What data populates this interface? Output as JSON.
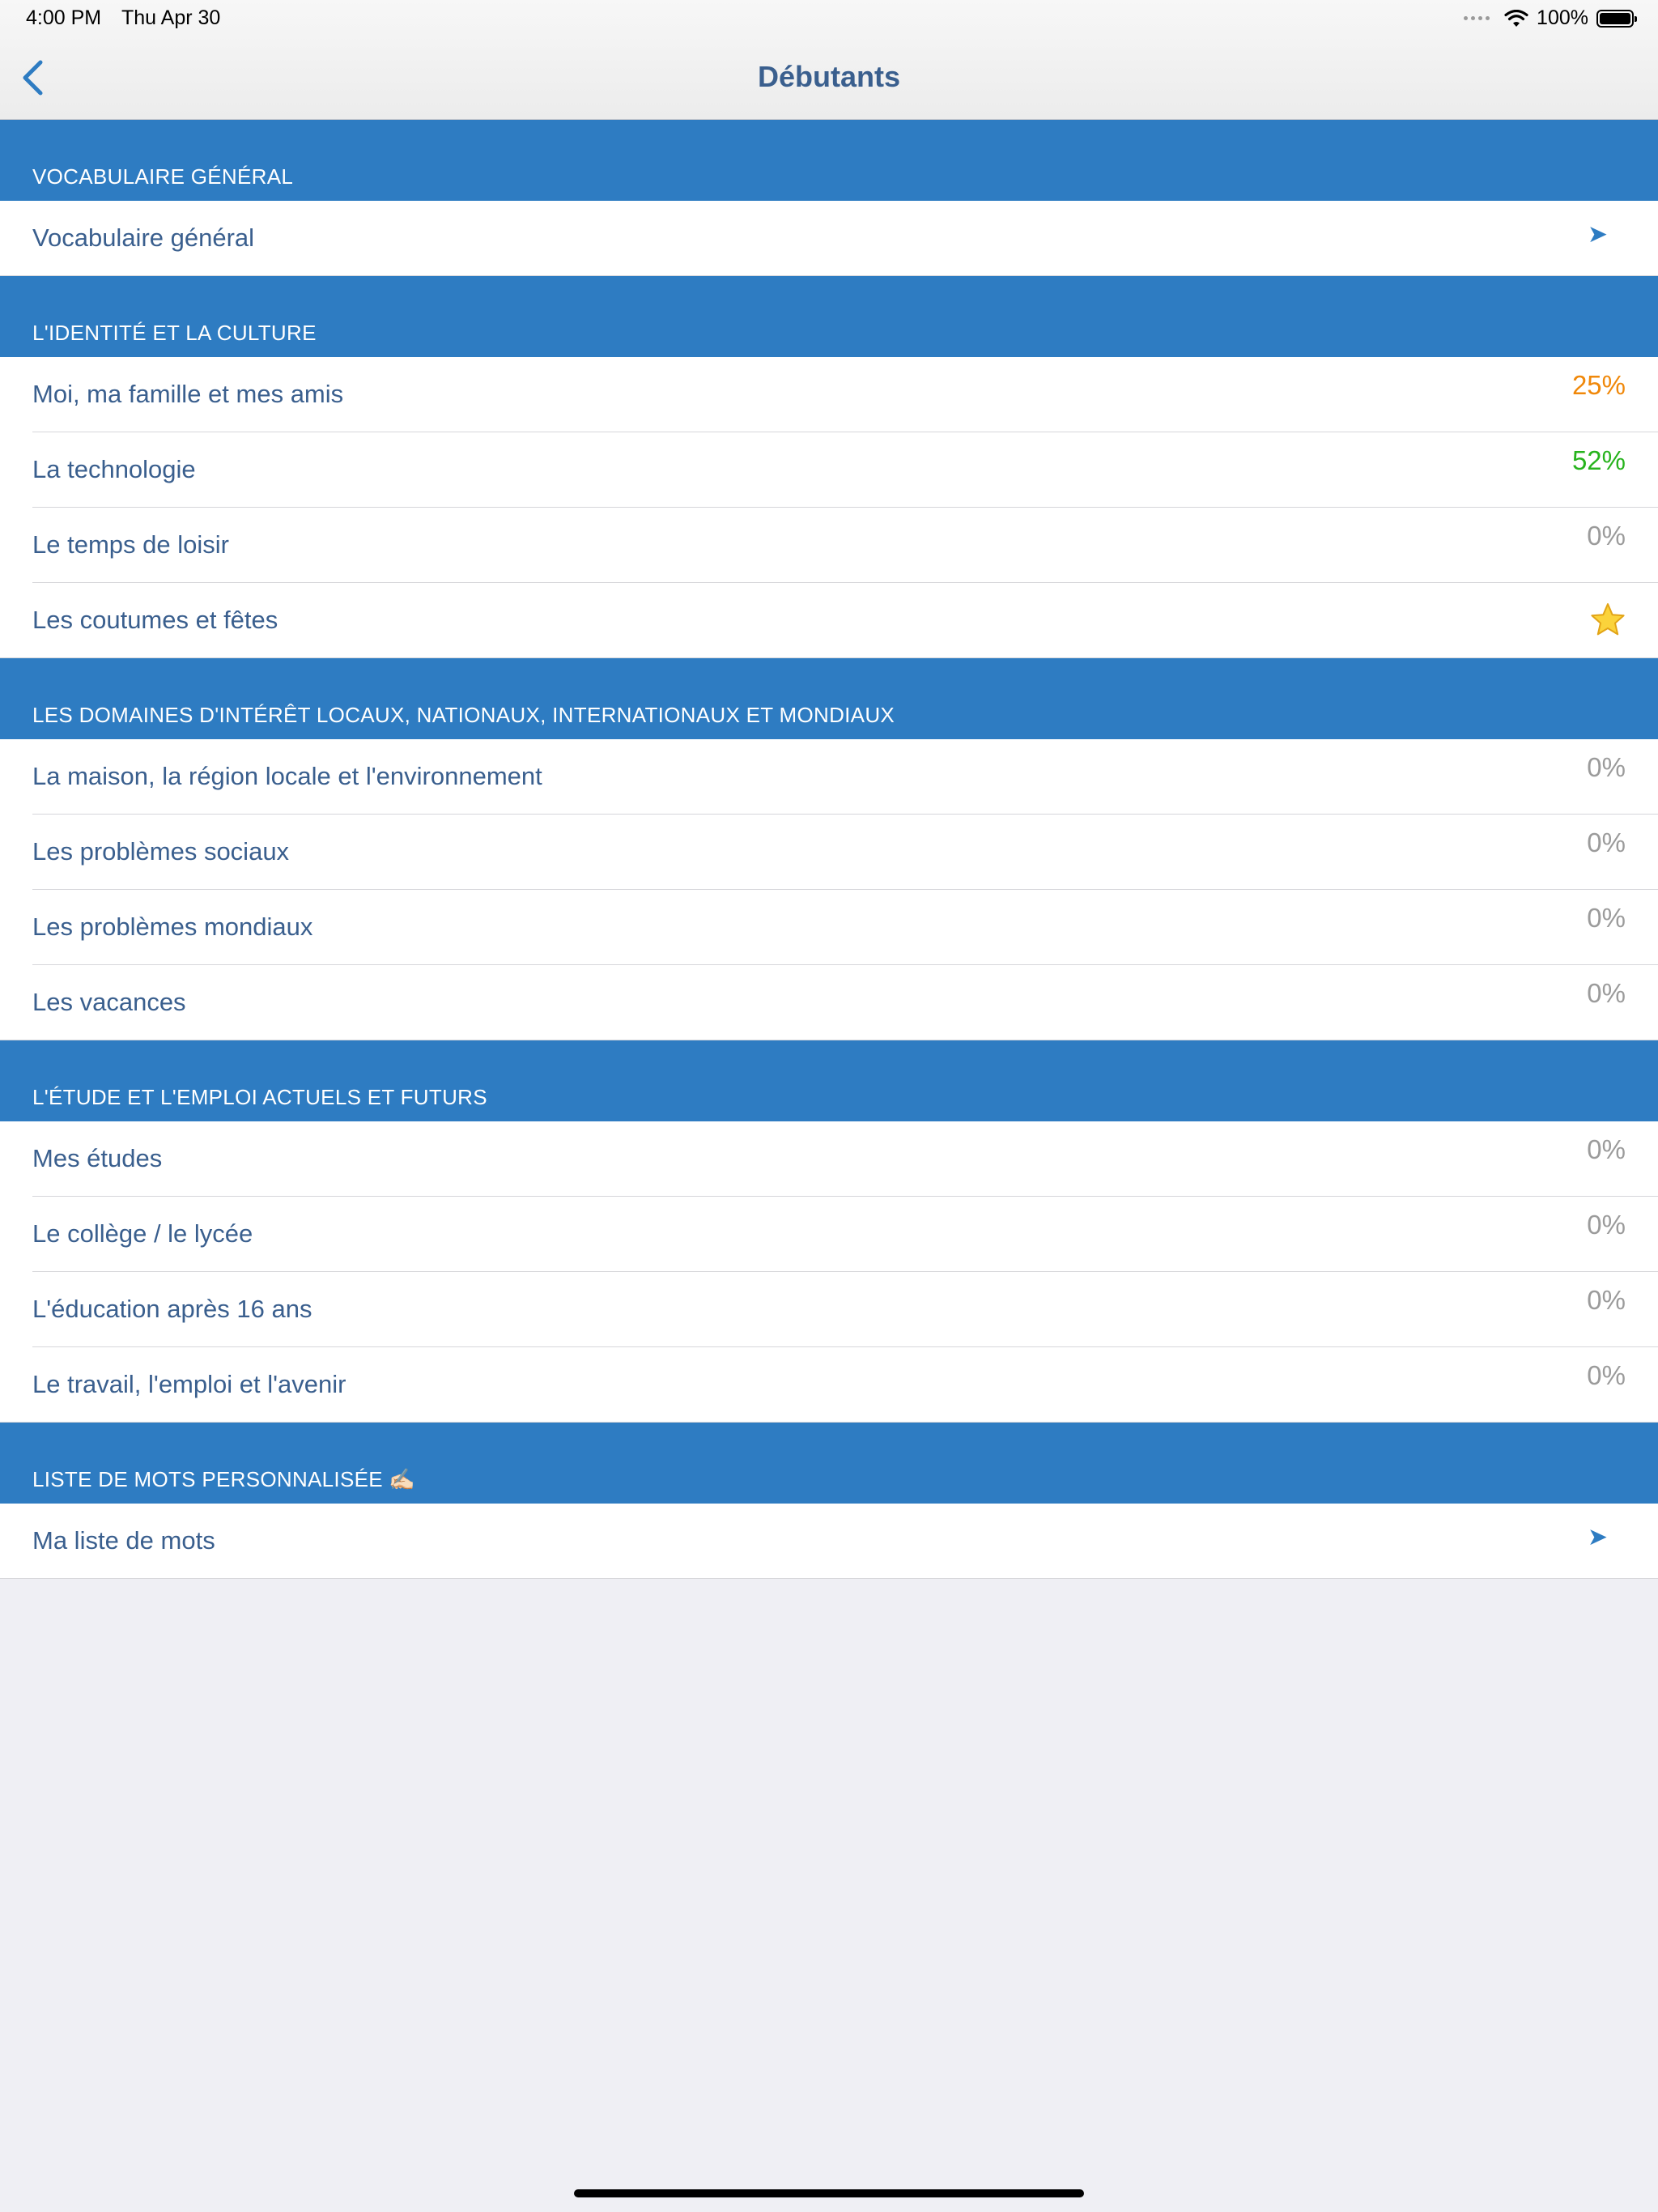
{
  "status_bar": {
    "time": "4:00 PM",
    "date": "Thu Apr 30",
    "battery": "100%"
  },
  "nav": {
    "title": "Débutants"
  },
  "colors": {
    "accent": "#2e7cc2",
    "text": "#3a5f8e",
    "orange": "#f0880a",
    "green": "#27b31d",
    "gray": "#9b9b9b"
  },
  "sections": [
    {
      "header": "VOCABULAIRE GÉNÉRAL",
      "rows": [
        {
          "label": "Vocabulaire général",
          "accessory": "arrow",
          "icon": "arrow-right-icon"
        }
      ]
    },
    {
      "header": "L'IDENTITÉ ET LA CULTURE",
      "rows": [
        {
          "label": "Moi, ma famille et mes amis",
          "value": "25%",
          "color": "#f0880a"
        },
        {
          "label": "La technologie",
          "value": "52%",
          "color": "#27b31d"
        },
        {
          "label": "Le temps de loisir",
          "value": "0%",
          "color": "#9b9b9b"
        },
        {
          "label": "Les coutumes et fêtes",
          "accessory": "star",
          "icon": "star-icon"
        }
      ]
    },
    {
      "header": "LES DOMAINES D'INTÉRÊT LOCAUX, NATIONAUX, INTERNATIONAUX ET MONDIAUX",
      "rows": [
        {
          "label": "La maison, la région locale et l'environnement",
          "value": "0%",
          "color": "#9b9b9b"
        },
        {
          "label": "Les problèmes sociaux",
          "value": "0%",
          "color": "#9b9b9b"
        },
        {
          "label": "Les problèmes mondiaux",
          "value": "0%",
          "color": "#9b9b9b"
        },
        {
          "label": "Les vacances",
          "value": "0%",
          "color": "#9b9b9b"
        }
      ]
    },
    {
      "header": "L'ÉTUDE ET L'EMPLOI ACTUELS ET FUTURS",
      "rows": [
        {
          "label": "Mes études",
          "value": "0%",
          "color": "#9b9b9b"
        },
        {
          "label": "Le collège / le lycée",
          "value": "0%",
          "color": "#9b9b9b"
        },
        {
          "label": "L'éducation après 16 ans",
          "value": "0%",
          "color": "#9b9b9b"
        },
        {
          "label": "Le travail, l'emploi et l'avenir",
          "value": "0%",
          "color": "#9b9b9b"
        }
      ]
    },
    {
      "header": "LISTE DE MOTS PERSONNALISÉE ✍🏻",
      "rows": [
        {
          "label": "Ma liste de mots",
          "accessory": "arrow",
          "icon": "arrow-right-icon"
        }
      ]
    }
  ]
}
